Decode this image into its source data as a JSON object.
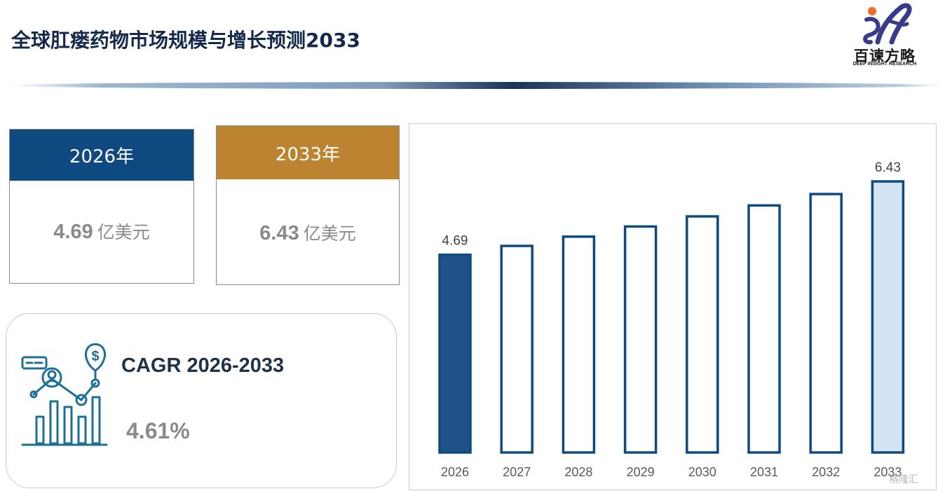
{
  "header": {
    "title": "全球肛瘘药物市场规模与增长预测2033"
  },
  "logo": {
    "icon": "brand-swirl-logo",
    "name": "百谏方略",
    "sub": "DEEP INSIGHT RESEARCH"
  },
  "cards": [
    {
      "year": "2026年",
      "value": "4.69",
      "unit": "亿美元",
      "color": "#0e4a80"
    },
    {
      "year": "2033年",
      "value": "6.43",
      "unit": "亿美元",
      "color": "#bc8431"
    }
  ],
  "cagr": {
    "label": "CAGR 2026-2033",
    "value": "4.61%",
    "icon": "growth-analytics-icon"
  },
  "chart_data": {
    "type": "bar",
    "categories": [
      "2026",
      "2027",
      "2028",
      "2029",
      "2030",
      "2031",
      "2032",
      "2033"
    ],
    "values": [
      4.69,
      4.9,
      5.12,
      5.36,
      5.6,
      5.86,
      6.13,
      6.43
    ],
    "data_labels": [
      "4.69",
      "",
      "",
      "",
      "",
      "",
      "",
      "6.43"
    ],
    "title": "",
    "xlabel": "",
    "ylabel": "",
    "ylim": [
      0,
      6.43
    ],
    "grid": false,
    "colors": {
      "outline": "#0e4a80",
      "first_fill": "#1f5286",
      "last_fill": "#d4e3f4",
      "other_fill": "#ffffff",
      "tick_text": "#595959"
    }
  },
  "watermark": "格隆汇"
}
